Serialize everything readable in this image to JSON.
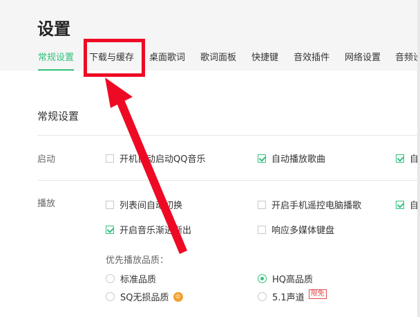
{
  "page": {
    "title": "设置"
  },
  "tabs": [
    {
      "label": "常规设置",
      "active": true
    },
    {
      "label": "下载与缓存",
      "active": false
    },
    {
      "label": "桌面歌词",
      "active": false
    },
    {
      "label": "歌词面板",
      "active": false
    },
    {
      "label": "快捷键",
      "active": false
    },
    {
      "label": "音效插件",
      "active": false
    },
    {
      "label": "网络设置",
      "active": false
    },
    {
      "label": "音频设",
      "active": false
    }
  ],
  "section": {
    "title": "常规设置"
  },
  "startup": {
    "label": "启动",
    "options": [
      {
        "label": "开机自动启动QQ音乐",
        "checked": false
      },
      {
        "label": "自动播放歌曲",
        "checked": true
      },
      {
        "label": "自",
        "checked": true
      }
    ]
  },
  "playback": {
    "label": "播放",
    "options": [
      {
        "label": "列表间自动切换",
        "checked": false
      },
      {
        "label": "开启手机遥控电脑播歌",
        "checked": false
      },
      {
        "label": "自",
        "checked": true
      },
      {
        "label": "开启音乐渐进渐出",
        "checked": true
      },
      {
        "label": "响应多媒体键盘",
        "checked": false
      }
    ]
  },
  "quality": {
    "label": "优先播放品质：",
    "options": [
      {
        "label": "标准品质",
        "selected": false
      },
      {
        "label": "HQ高品质",
        "selected": true
      },
      {
        "label": "SQ无损品质",
        "selected": false,
        "badge": "♔"
      },
      {
        "label": "5.1声道",
        "selected": false,
        "badge": "限免"
      }
    ]
  },
  "colors": {
    "accent": "#31c27c",
    "annotation": "#ee0a24"
  },
  "icons": {
    "check": "check-icon",
    "radio": "radio-icon",
    "vip": "vip-crown-icon",
    "arrow": "annotation-arrow"
  }
}
